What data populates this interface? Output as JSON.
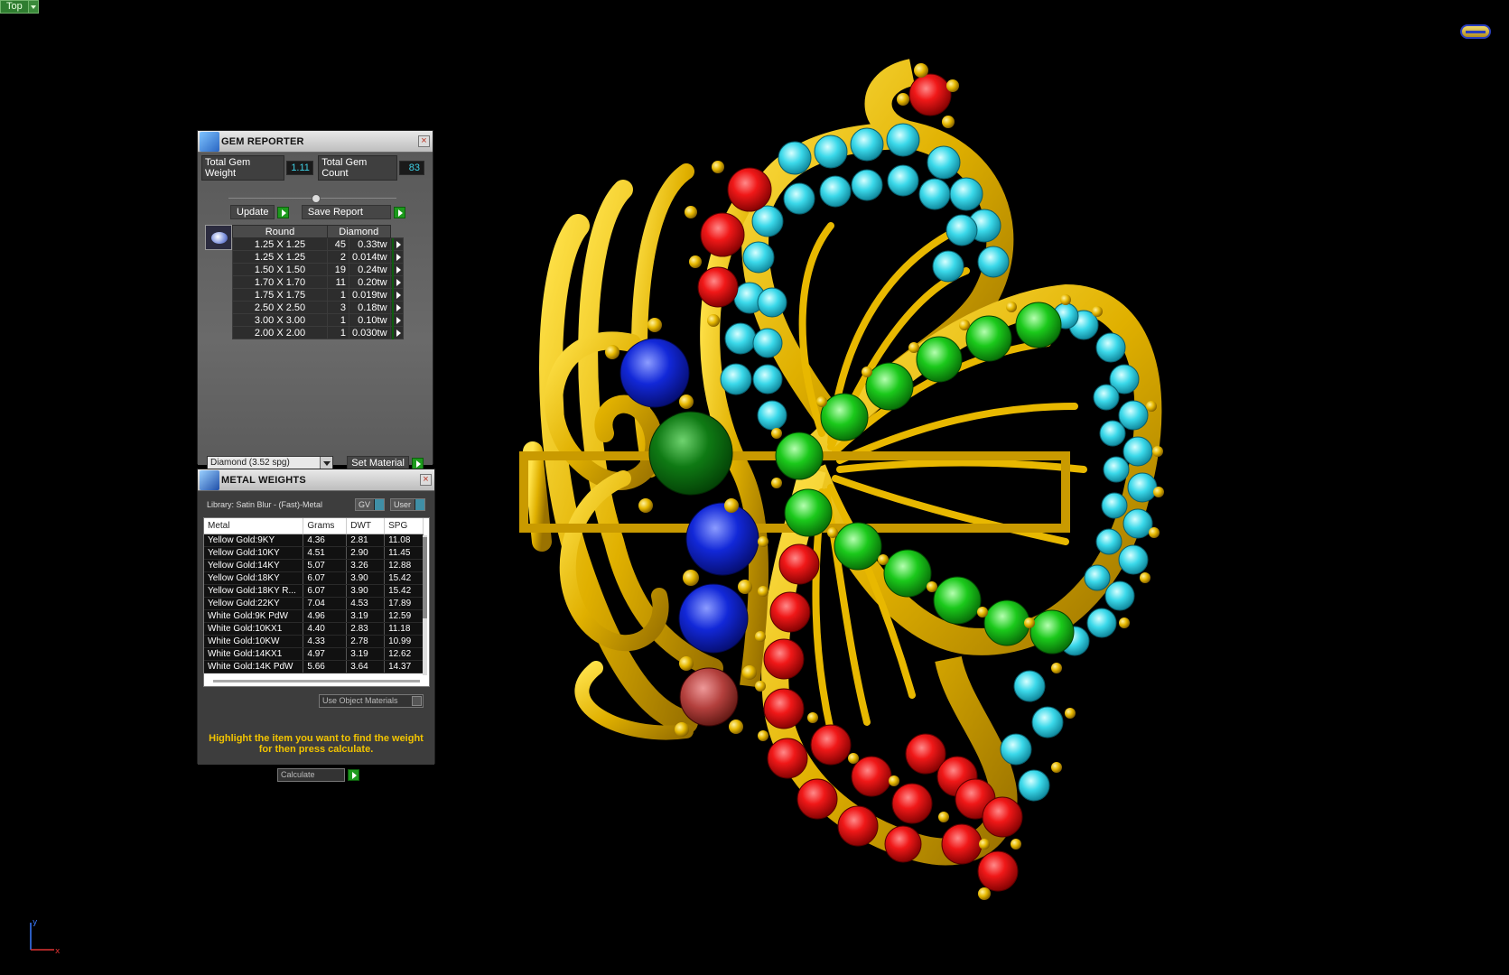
{
  "viewport": {
    "label": "Top"
  },
  "gem_reporter": {
    "title": "GEM REPORTER",
    "total_weight_label": "Total Gem Weight",
    "total_weight_value": "1.11",
    "total_count_label": "Total Gem Count",
    "total_count_value": "83",
    "update_label": "Update",
    "save_label": "Save Report",
    "columns": [
      "Round",
      "Diamond"
    ],
    "rows": [
      {
        "size": "1.25 X 1.25",
        "count": "45",
        "weight": "0.33tw"
      },
      {
        "size": "1.25 X 1.25",
        "count": "2",
        "weight": "0.014tw"
      },
      {
        "size": "1.50 X 1.50",
        "count": "19",
        "weight": "0.24tw"
      },
      {
        "size": "1.70 X 1.70",
        "count": "11",
        "weight": "0.20tw"
      },
      {
        "size": "1.75 X 1.75",
        "count": "1",
        "weight": "0.019tw"
      },
      {
        "size": "2.50 X 2.50",
        "count": "3",
        "weight": "0.18tw"
      },
      {
        "size": "3.00 X 3.00",
        "count": "1",
        "weight": "0.10tw"
      },
      {
        "size": "2.00 X 2.00",
        "count": "1",
        "weight": "0.030tw"
      }
    ],
    "material_select": "Diamond     (3.52 spg)",
    "set_material_label": "Set Material"
  },
  "metal_weights": {
    "title": "METAL WEIGHTS",
    "library_label": "Library: Satin Blur - (Fast)-Metal",
    "gv_label": "GV",
    "user_label": "User",
    "columns": [
      "Metal",
      "Grams",
      "DWT",
      "SPG"
    ],
    "rows": [
      {
        "metal": "Yellow Gold:9KY",
        "grams": "4.36",
        "dwt": "2.81",
        "spg": "11.08"
      },
      {
        "metal": "Yellow Gold:10KY",
        "grams": "4.51",
        "dwt": "2.90",
        "spg": "11.45"
      },
      {
        "metal": "Yellow Gold:14KY",
        "grams": "5.07",
        "dwt": "3.26",
        "spg": "12.88"
      },
      {
        "metal": "Yellow Gold:18KY",
        "grams": "6.07",
        "dwt": "3.90",
        "spg": "15.42"
      },
      {
        "metal": "Yellow Gold:18KY R...",
        "grams": "6.07",
        "dwt": "3.90",
        "spg": "15.42"
      },
      {
        "metal": "Yellow Gold:22KY",
        "grams": "7.04",
        "dwt": "4.53",
        "spg": "17.89"
      },
      {
        "metal": "White Gold:9K PdW",
        "grams": "4.96",
        "dwt": "3.19",
        "spg": "12.59"
      },
      {
        "metal": "White Gold:10KX1",
        "grams": "4.40",
        "dwt": "2.83",
        "spg": "11.18"
      },
      {
        "metal": "White Gold:10KW",
        "grams": "4.33",
        "dwt": "2.78",
        "spg": "10.99"
      },
      {
        "metal": "White Gold:14KX1",
        "grams": "4.97",
        "dwt": "3.19",
        "spg": "12.62"
      },
      {
        "metal": "White Gold:14K PdW",
        "grams": "5.66",
        "dwt": "3.64",
        "spg": "14.37"
      }
    ],
    "use_object_materials": "Use Object Materials",
    "hint": "Highlight the item you want to find the weight for then press calculate.",
    "calculate_label": "Calculate"
  },
  "colors": {
    "gold": "#e0b400",
    "ruby": "#e01010",
    "aquamarine": "#38d8e8",
    "emerald": "#17c417",
    "sapphire": "#1024d0",
    "hint_text": "#f2c400"
  }
}
